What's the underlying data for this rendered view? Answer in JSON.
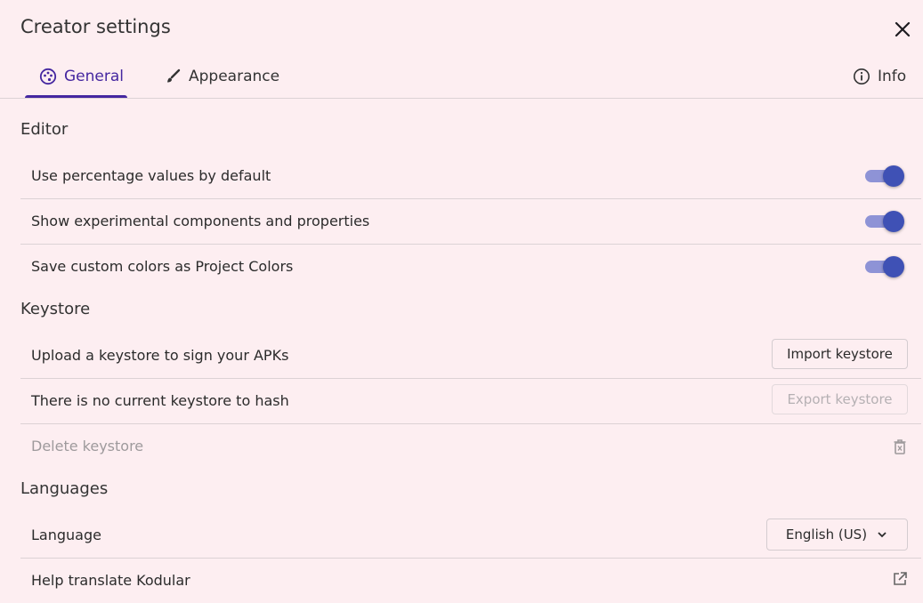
{
  "dialog": {
    "title": "Creator settings"
  },
  "tabs": [
    {
      "label": "General",
      "icon": "palette-icon",
      "active": true
    },
    {
      "label": "Appearance",
      "icon": "brush-icon",
      "active": false
    }
  ],
  "info_tab": {
    "label": "Info",
    "icon": "info-icon"
  },
  "editor": {
    "title": "Editor",
    "settings": [
      {
        "label": "Use percentage values by default",
        "enabled": true
      },
      {
        "label": "Show experimental components and properties",
        "enabled": true
      },
      {
        "label": "Save custom colors as Project Colors",
        "enabled": true
      }
    ]
  },
  "keystore": {
    "title": "Keystore",
    "upload_label": "Upload a keystore to sign your APKs",
    "import_button": "Import keystore",
    "hash_label": "There is no current keystore to hash",
    "export_button": "Export keystore",
    "delete_label": "Delete keystore"
  },
  "languages": {
    "title": "Languages",
    "language_label": "Language",
    "language_value": "English (US)",
    "partial_label": "Help translate Kodular"
  },
  "colors": {
    "background": "#fdeef1",
    "accent": "#4527a0",
    "toggle_on": "#3f51b5"
  }
}
